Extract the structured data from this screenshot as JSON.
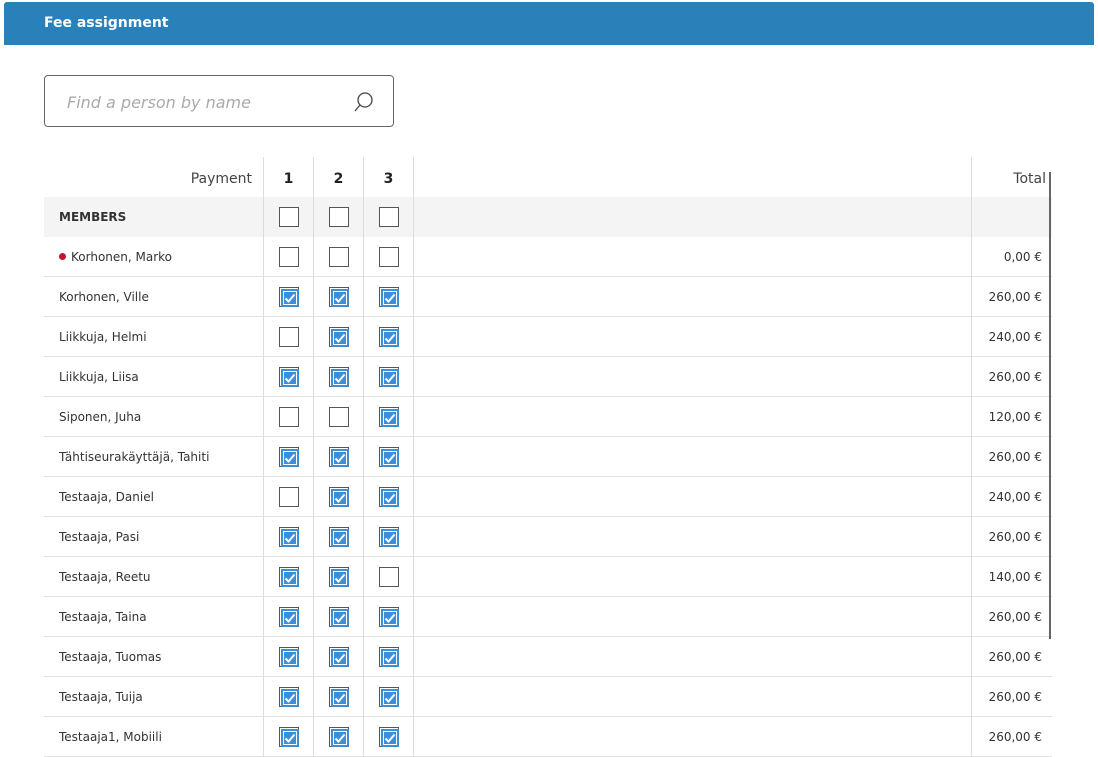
{
  "panel": {
    "title": "Fee assignment"
  },
  "search": {
    "placeholder": "Find a person by name",
    "value": ""
  },
  "table": {
    "payment_label": "Payment",
    "columns": [
      "1",
      "2",
      "3"
    ],
    "total_label": "Total",
    "group_label": "MEMBERS",
    "group_checks": [
      false,
      false,
      false
    ],
    "rows": [
      {
        "name": "Korhonen, Marko",
        "flag": true,
        "checks": [
          false,
          false,
          false
        ],
        "total": "0,00 €"
      },
      {
        "name": "Korhonen, Ville",
        "flag": false,
        "checks": [
          true,
          true,
          true
        ],
        "total": "260,00 €"
      },
      {
        "name": "Liikkuja, Helmi",
        "flag": false,
        "checks": [
          false,
          true,
          true
        ],
        "total": "240,00 €"
      },
      {
        "name": "Liikkuja, Liisa",
        "flag": false,
        "checks": [
          true,
          true,
          true
        ],
        "total": "260,00 €"
      },
      {
        "name": "Siponen, Juha",
        "flag": false,
        "checks": [
          false,
          false,
          true
        ],
        "total": "120,00 €"
      },
      {
        "name": "Tähtiseurakäyttäjä, Tahiti",
        "flag": false,
        "checks": [
          true,
          true,
          true
        ],
        "total": "260,00 €"
      },
      {
        "name": "Testaaja, Daniel",
        "flag": false,
        "checks": [
          false,
          true,
          true
        ],
        "total": "240,00 €"
      },
      {
        "name": "Testaaja, Pasi",
        "flag": false,
        "checks": [
          true,
          true,
          true
        ],
        "total": "260,00 €"
      },
      {
        "name": "Testaaja, Reetu",
        "flag": false,
        "checks": [
          true,
          true,
          false
        ],
        "total": "140,00 €"
      },
      {
        "name": "Testaaja, Taina",
        "flag": false,
        "checks": [
          true,
          true,
          true
        ],
        "total": "260,00 €"
      },
      {
        "name": "Testaaja, Tuomas",
        "flag": false,
        "checks": [
          true,
          true,
          true
        ],
        "total": "260,00 €"
      },
      {
        "name": "Testaaja, Tuija",
        "flag": false,
        "checks": [
          true,
          true,
          true
        ],
        "total": "260,00 €"
      },
      {
        "name": "Testaaja1, Mobiili",
        "flag": false,
        "checks": [
          true,
          true,
          true
        ],
        "total": "260,00 €"
      }
    ]
  },
  "colors": {
    "header_bg": "#2a80b9",
    "checkbox_on": "#3a8fd8",
    "flag_dot": "#c8102e"
  }
}
